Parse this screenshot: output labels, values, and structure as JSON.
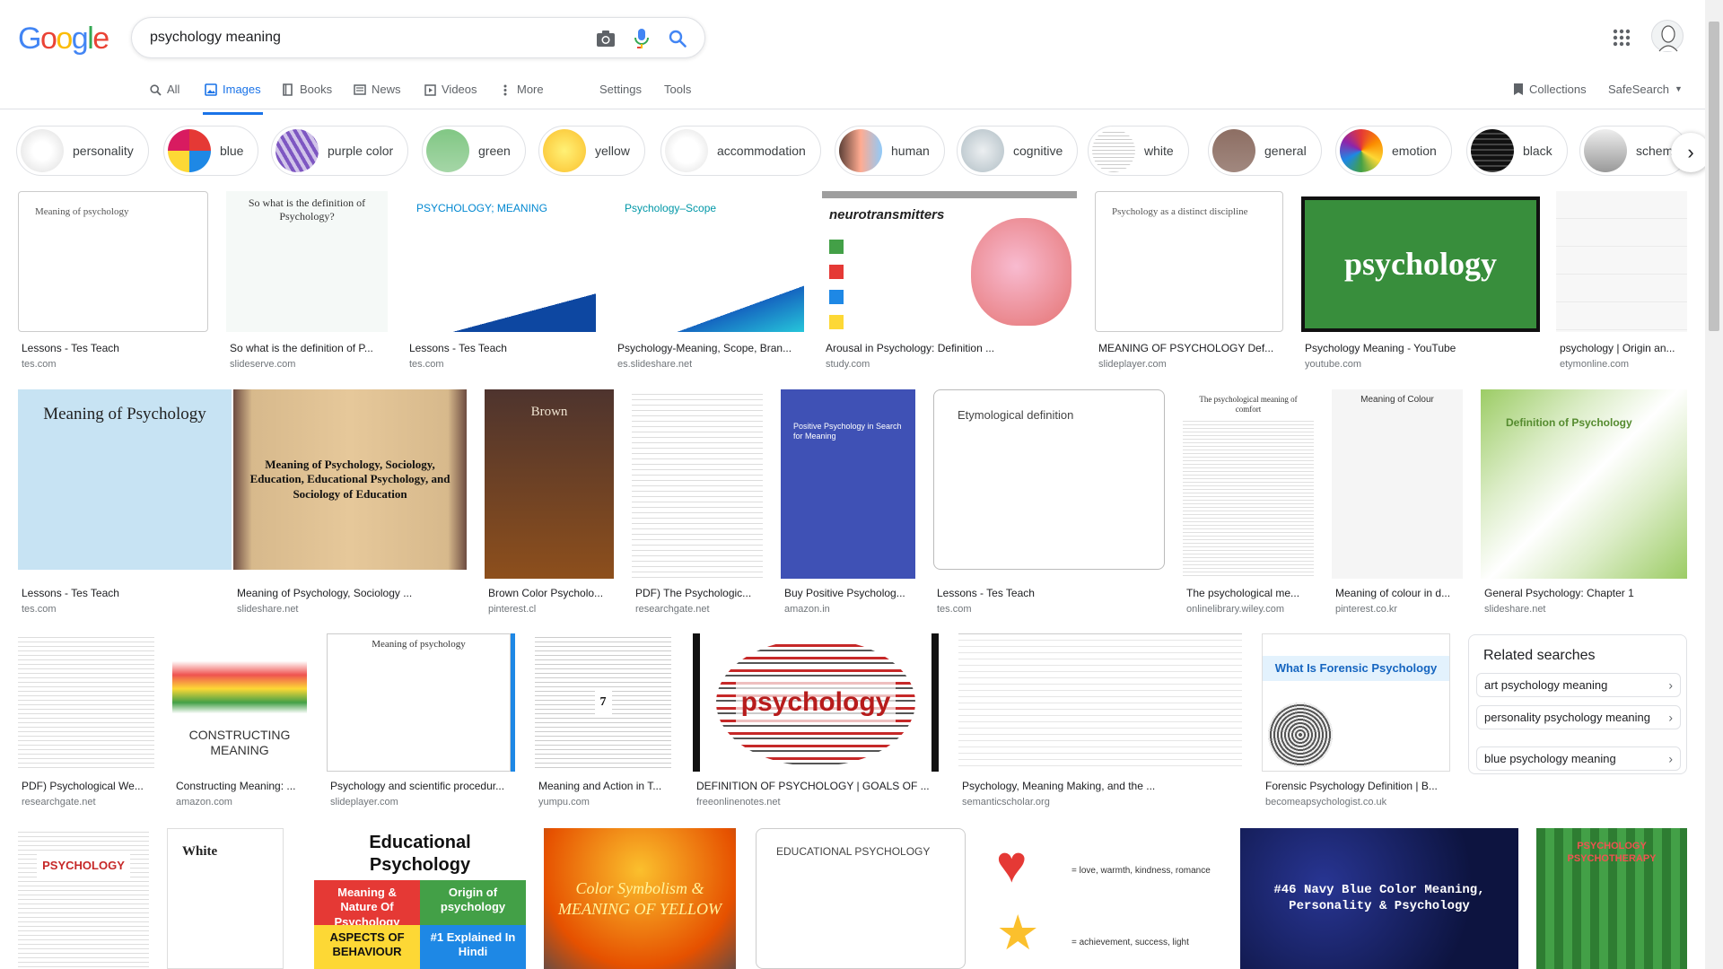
{
  "logo": "Google",
  "search": {
    "query": "psychology meaning"
  },
  "tabs": [
    {
      "label": "All"
    },
    {
      "label": "Images"
    },
    {
      "label": "Books"
    },
    {
      "label": "News"
    },
    {
      "label": "Videos"
    },
    {
      "label": "More"
    }
  ],
  "settings_label": "Settings",
  "tools_label": "Tools",
  "collections_label": "Collections",
  "safesearch_label": "SafeSearch",
  "chips": [
    "personality",
    "blue",
    "purple color",
    "green",
    "yellow",
    "accommodation",
    "human",
    "cognitive",
    "white",
    "general",
    "emotion",
    "black",
    "schem"
  ],
  "results_row1": [
    {
      "title": "Lessons - Tes Teach",
      "source": "tes.com",
      "img_text": "Meaning of psychology"
    },
    {
      "title": "So what is the definition of P...",
      "source": "slideserve.com",
      "img_text": "So what is the definition of Psychology?"
    },
    {
      "title": "Lessons - Tes Teach",
      "source": "tes.com",
      "img_text": "PSYCHOLOGY; MEANING"
    },
    {
      "title": "Psychology-Meaning, Scope, Bran...",
      "source": "es.slideshare.net",
      "img_text": "Psychology–Scope"
    },
    {
      "title": "Arousal in Psychology: Definition ...",
      "source": "study.com",
      "img_text": "neurotransmitters"
    },
    {
      "title": "MEANING OF PSYCHOLOGY Def...",
      "source": "slideplayer.com",
      "img_text": "Psychology as a distinct discipline"
    },
    {
      "title": "Psychology Meaning - YouTube",
      "source": "youtube.com",
      "img_text": "psychology"
    },
    {
      "title": "psychology | Origin an...",
      "source": "etymonline.com",
      "img_text": ""
    }
  ],
  "results_row2": [
    {
      "title": "Lessons - Tes Teach",
      "source": "tes.com",
      "img_text": "Meaning of Psychology"
    },
    {
      "title": "Meaning of Psychology, Sociology ...",
      "source": "slideshare.net",
      "img_text": "Meaning of Psychology, Sociology, Education, Educational Psychology, and Sociology of Education"
    },
    {
      "title": "Brown Color Psycholo...",
      "source": "pinterest.cl",
      "img_text": "Brown"
    },
    {
      "title": "PDF) The Psychologic...",
      "source": "researchgate.net",
      "img_text": ""
    },
    {
      "title": "Buy Positive Psycholog...",
      "source": "amazon.in",
      "img_text": "Positive Psychology in Search for Meaning"
    },
    {
      "title": "Lessons - Tes Teach",
      "source": "tes.com",
      "img_text": "Etymological definition"
    },
    {
      "title": "The psychological me...",
      "source": "onlinelibrary.wiley.com",
      "img_text": "The psychological meaning of comfort"
    },
    {
      "title": "Meaning of colour in d...",
      "source": "pinterest.co.kr",
      "img_text": "Meaning of Colour"
    },
    {
      "title": "General Psychology: Chapter 1",
      "source": "slideshare.net",
      "img_text": "Definition of Psychology"
    }
  ],
  "results_row3": [
    {
      "title": "PDF) Psychological We...",
      "source": "researchgate.net",
      "img_text": ""
    },
    {
      "title": "Constructing Meaning: ...",
      "source": "amazon.com",
      "img_text": "CONSTRUCTING MEANING"
    },
    {
      "title": "Psychology and scientific procedur...",
      "source": "slideplayer.com",
      "img_text": "Meaning of psychology"
    },
    {
      "title": "Meaning and Action in T...",
      "source": "yumpu.com",
      "img_text": "7"
    },
    {
      "title": "DEFINITION OF PSYCHOLOGY | GOALS OF ...",
      "source": "freeonlinenotes.net",
      "img_text": "psychology"
    },
    {
      "title": "Psychology, Meaning Making, and the ...",
      "source": "semanticscholar.org",
      "img_text": ""
    },
    {
      "title": "Forensic Psychology Definition | B...",
      "source": "becomeapsychologist.co.uk",
      "img_text": "What Is Forensic Psychology"
    }
  ],
  "row4": [
    {
      "img_text": "PSYCHOLOGY"
    },
    {
      "img_text": "White"
    },
    {
      "img_text": "Educational Psychology"
    },
    {
      "img_text": "Color Symbolism & MEANING OF YELLOW"
    },
    {
      "img_text": "EDUCATIONAL PSYCHOLOGY"
    },
    {
      "img_text": "= love, warmth, kindness, romance"
    },
    {
      "img_text": "#46 Navy Blue Color Meaning, Personality & Psychology"
    },
    {
      "img_text": "PSYCHOLOGY PSYCHOTHERAPY"
    }
  ],
  "row4_extra": {
    "star_caption": "= achievement, success, light",
    "edpsy_meaning": "Meaning & Nature Of Psychology",
    "edpsy_origin": "Origin of psychology",
    "edpsy_aspects": "ASPECTS OF BEHAVIOUR",
    "edpsy_hindi": "#1 Explained In Hindi"
  },
  "related": {
    "heading": "Related searches",
    "items": [
      "art psychology meaning",
      "personality psychology meaning",
      "blue psychology meaning"
    ]
  },
  "colors": {
    "accent": "#1a73e8",
    "text_secondary": "#5f6368"
  }
}
